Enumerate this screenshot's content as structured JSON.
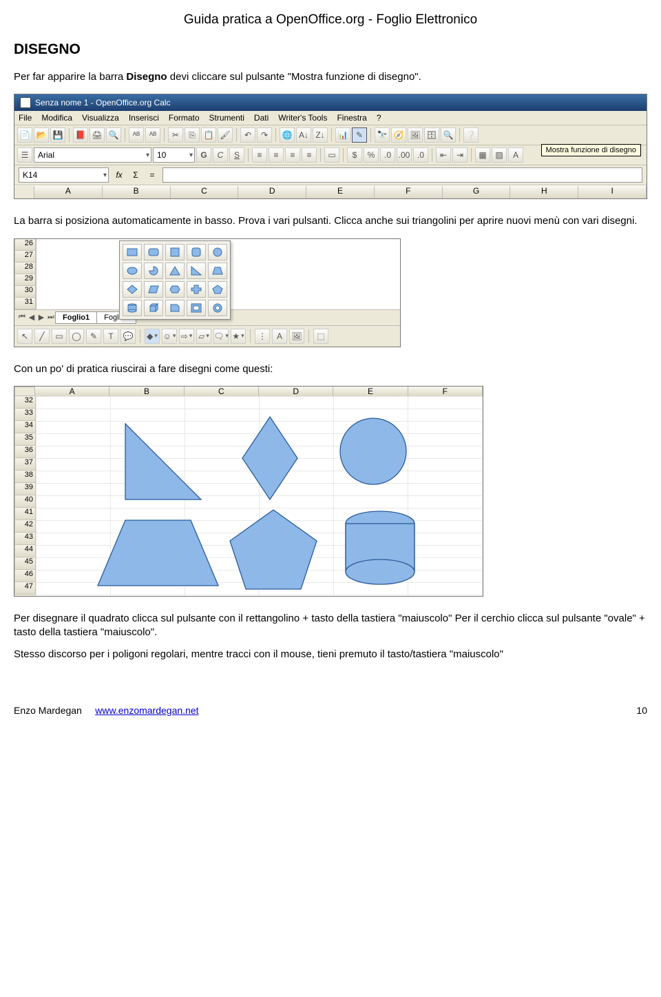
{
  "header": "Guida pratica a OpenOffice.org - Foglio Elettronico",
  "section_title": "DISEGNO",
  "para1_pre": "Per far apparire la barra ",
  "para1_bold": "Disegno",
  "para1_post": " devi cliccare sul pulsante \"Mostra funzione di disegno\".",
  "para2": "La barra si posiziona automaticamente in basso. Prova i vari pulsanti. Clicca anche sui triangolini per aprire nuovi menù con vari disegni.",
  "para3": "Con un po' di pratica riuscirai a fare disegni come questi:",
  "para4": "Per disegnare il quadrato clicca sul pulsante con il rettangolino + tasto della tastiera \"maiuscolo\" Per il cerchio clicca sul pulsante \"ovale\" + tasto della tastiera \"maiuscolo\".",
  "para5": "Stesso discorso per i poligoni regolari, mentre tracci con il mouse, tieni premuto il tasto/tastiera \"maiuscolo\"",
  "footer": {
    "author": "Enzo Mardegan",
    "url": "www.enzomardegan.net",
    "page": "10"
  },
  "shot1": {
    "title": "Senza nome 1 - OpenOffice.org Calc",
    "menu": [
      "File",
      "Modifica",
      "Visualizza",
      "Inserisci",
      "Formato",
      "Strumenti",
      "Dati",
      "Writer's Tools",
      "Finestra",
      "?"
    ],
    "font": "Arial",
    "size": "10",
    "cellref": "K14",
    "cols": [
      "A",
      "B",
      "C",
      "D",
      "E",
      "F",
      "G",
      "H",
      "I"
    ],
    "tooltip": "Mostra funzione di disegno"
  },
  "shot2": {
    "rows": [
      "26",
      "27",
      "28",
      "29",
      "30",
      "31"
    ],
    "tabs": [
      "Foglio1",
      "Foglio2"
    ]
  },
  "shot3": {
    "cols": [
      "A",
      "B",
      "C",
      "D",
      "E",
      "F"
    ],
    "rows": [
      "32",
      "33",
      "34",
      "35",
      "36",
      "37",
      "38",
      "39",
      "40",
      "41",
      "42",
      "43",
      "44",
      "45",
      "46",
      "47"
    ]
  }
}
